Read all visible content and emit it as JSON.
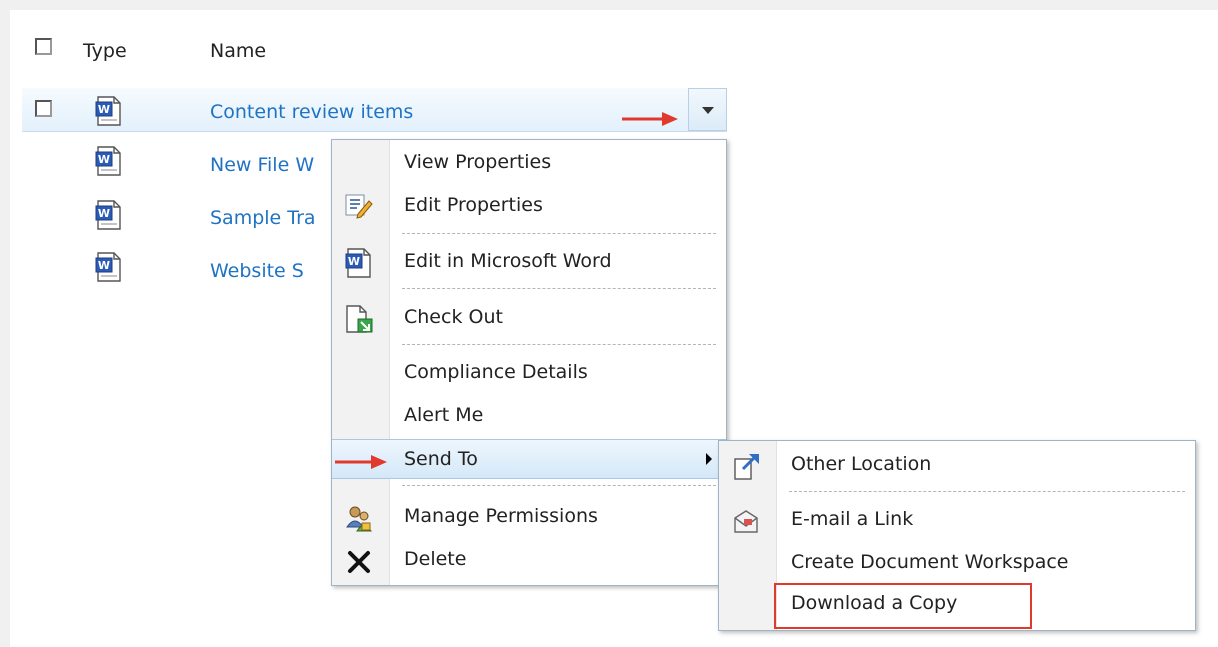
{
  "header": {
    "type_label": "Type",
    "name_label": "Name"
  },
  "rows": [
    {
      "name": "Content review items"
    },
    {
      "name": "New File W"
    },
    {
      "name": "Sample Tra"
    },
    {
      "name": "Website S"
    }
  ],
  "context_menu": {
    "items": [
      "View Properties",
      "Edit Properties",
      "Edit in Microsoft Word",
      "Check Out",
      "Compliance Details",
      "Alert Me",
      "Send To",
      "Manage Permissions",
      "Delete"
    ]
  },
  "submenu": {
    "items": [
      "Other Location",
      "E-mail a Link",
      "Create Document Workspace",
      "Download a Copy"
    ]
  },
  "colors": {
    "link": "#1f73c4",
    "annotation": "#e03a2e",
    "highlight": "#d5e8f8"
  },
  "icons": [
    "word-doc-icon",
    "edit-properties-icon",
    "checkout-icon",
    "permissions-icon",
    "delete-icon",
    "other-location-icon",
    "email-link-icon",
    "dropdown-arrow-icon"
  ]
}
